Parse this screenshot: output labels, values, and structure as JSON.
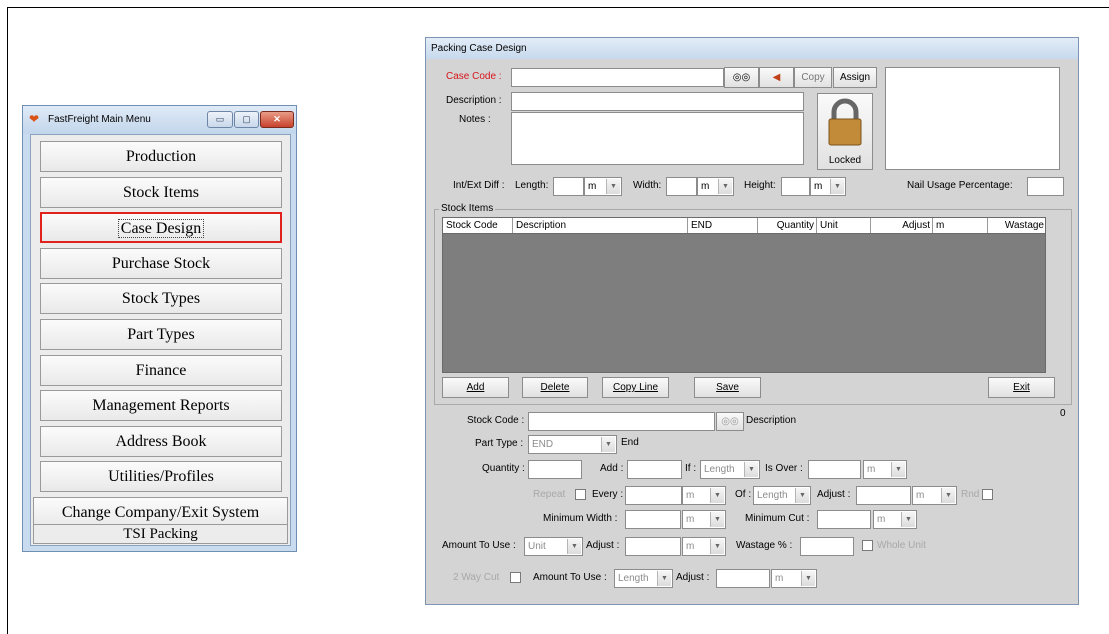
{
  "main_menu": {
    "title": "FastFreight Main Menu",
    "window_buttons": {
      "minimize": "▭",
      "maximize": "▢",
      "close": "✕"
    },
    "items": [
      {
        "label": "Production",
        "selected": false
      },
      {
        "label": "Stock Items",
        "selected": false
      },
      {
        "label": "Case Design",
        "selected": true
      },
      {
        "label": "Purchase Stock",
        "selected": false
      },
      {
        "label": "Stock Types",
        "selected": false
      },
      {
        "label": "Part Types",
        "selected": false
      },
      {
        "label": "Finance",
        "selected": false
      },
      {
        "label": "Management Reports",
        "selected": false
      },
      {
        "label": "Address Book",
        "selected": false
      },
      {
        "label": "Utilities/Profiles",
        "selected": false
      },
      {
        "label": "Change Company/Exit System",
        "selected": false
      }
    ],
    "status": "TSI Packing"
  },
  "case_design": {
    "title": "Packing Case Design",
    "case_code_label": "Case Code :",
    "case_code_value": "",
    "copy_button": "Copy",
    "assign_button": "Assign",
    "description_label": "Description :",
    "description_value": "",
    "notes_label": "Notes :",
    "notes_value": "",
    "lock_label": "Locked",
    "int_ext_diff_label": "Int/Ext Diff :",
    "length_label": "Length:",
    "width_label": "Width:",
    "height_label": "Height:",
    "unit_m": "m",
    "nail_usage_label": "Nail Usage Percentage:",
    "nail_usage_value": "",
    "stock_items_group": "Stock Items",
    "grid_columns": [
      "Stock Code",
      "Description",
      "END",
      "Quantity",
      "Unit",
      "Adjust",
      "m",
      "Wastage"
    ],
    "grid_rows": [],
    "add_button": "Add",
    "delete_button": "Delete",
    "copy_line_button": "Copy Line",
    "save_button": "Save",
    "exit_button": "Exit",
    "zero_count": "0",
    "stock_code_label": "Stock Code :",
    "stock_code_value": "",
    "description_text": "Description",
    "part_type_label": "Part Type :",
    "part_type_value": "END",
    "part_type_text": "End",
    "quantity_label": "Quantity :",
    "add_label": "Add :",
    "if_label": "If :",
    "if_value": "Length",
    "is_over_label": "Is Over :",
    "repeat_label": "Repeat",
    "every_label": "Every :",
    "of_label": "Of :",
    "of_value": "Length",
    "adjust_label": "Adjust :",
    "rnd_label": "Rnd",
    "min_width_label": "Minimum Width :",
    "min_cut_label": "Minimum Cut :",
    "amount_to_use_label": "Amount To Use :",
    "amount_to_use_value": "Unit",
    "wastage_label": "Wastage % :",
    "whole_unit_label": "Whole Unit",
    "two_way_cut_label": "2 Way Cut",
    "amount_to_use_2_value": "Length"
  }
}
